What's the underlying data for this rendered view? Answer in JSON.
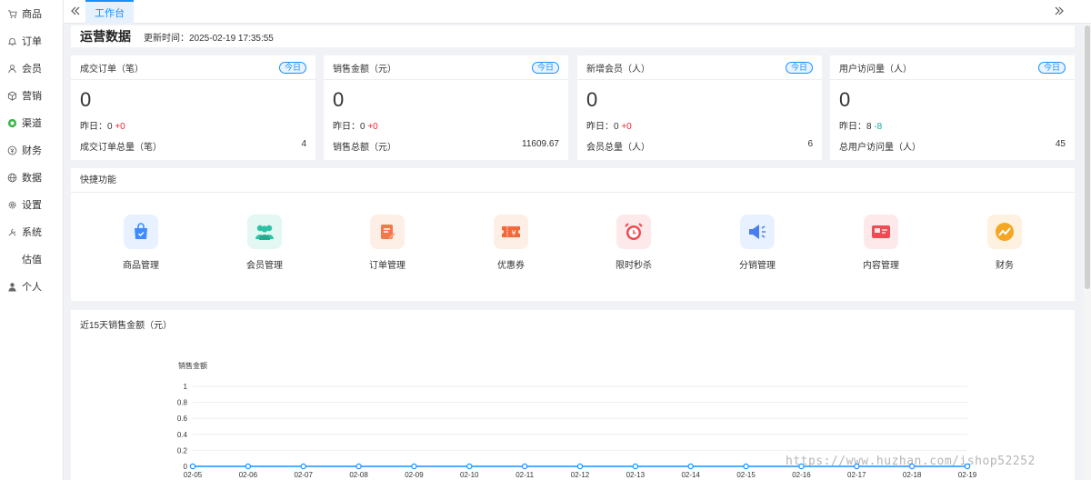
{
  "sidebar": {
    "items": [
      {
        "label": "商品",
        "icon": "cart-icon"
      },
      {
        "label": "订单",
        "icon": "bell-icon"
      },
      {
        "label": "会员",
        "icon": "user-icon"
      },
      {
        "label": "营销",
        "icon": "box-icon"
      },
      {
        "label": "渠道",
        "icon": "channel-icon"
      },
      {
        "label": "财务",
        "icon": "finance-icon"
      },
      {
        "label": "数据",
        "icon": "globe-icon"
      },
      {
        "label": "设置",
        "icon": "gear-icon"
      },
      {
        "label": "系统",
        "icon": "tools-icon"
      },
      {
        "label": "估值",
        "icon": ""
      },
      {
        "label": "个人",
        "icon": "person-icon"
      }
    ]
  },
  "topbar": {
    "tab_label": "工作台"
  },
  "header": {
    "title": "运营数据",
    "update_label": "更新时间：2025-02-19 17:35:55"
  },
  "stats": [
    {
      "title": "成交订单（笔）",
      "badge": "今日",
      "value": "0",
      "yesterday_label": "昨日：",
      "yesterday_value": "0",
      "change": "+0",
      "total_label": "成交订单总量（笔）",
      "total_value": "4"
    },
    {
      "title": "销售金额（元）",
      "badge": "今日",
      "value": "0",
      "yesterday_label": "昨日：",
      "yesterday_value": "0",
      "change": "+0",
      "total_label": "销售总额（元）",
      "total_value": "11609.67"
    },
    {
      "title": "新增会员（人）",
      "badge": "今日",
      "value": "0",
      "yesterday_label": "昨日：",
      "yesterday_value": "0",
      "change": "+0",
      "total_label": "会员总量（人）",
      "total_value": "6"
    },
    {
      "title": "用户访问量（人）",
      "badge": "今日",
      "value": "0",
      "yesterday_label": "昨日：",
      "yesterday_value": "8",
      "change": "-8",
      "total_label": "总用户访问量（人）",
      "total_value": "45"
    }
  ],
  "quick": {
    "title": "快捷功能",
    "items": [
      {
        "label": "商品管理",
        "icon": "shopping-bag-icon",
        "bg": "#e8f1ff",
        "color": "#3d8bfd"
      },
      {
        "label": "会员管理",
        "icon": "members-icon",
        "bg": "#e3f7f3",
        "color": "#2cc2a4"
      },
      {
        "label": "订单管理",
        "icon": "order-icon",
        "bg": "#fdeee6",
        "color": "#f27a4a"
      },
      {
        "label": "优惠券",
        "icon": "coupon-icon",
        "bg": "#fdeee6",
        "color": "#f26a3a"
      },
      {
        "label": "限时秒杀",
        "icon": "alarm-clock-icon",
        "bg": "#fde9ea",
        "color": "#f0484f"
      },
      {
        "label": "分销管理",
        "icon": "megaphone-icon",
        "bg": "#e8f1ff",
        "color": "#4a7df0"
      },
      {
        "label": "内容管理",
        "icon": "content-icon",
        "bg": "#fde9ea",
        "color": "#ef4b55"
      },
      {
        "label": "财务",
        "icon": "trend-icon",
        "bg": "#fff1e0",
        "color": "#f5a623"
      }
    ]
  },
  "chart_data": {
    "type": "line",
    "title": "近15天销售金额（元）",
    "ylabel": "销售金额",
    "xlabel": "",
    "categories": [
      "02-05",
      "02-06",
      "02-07",
      "02-08",
      "02-09",
      "02-10",
      "02-11",
      "02-12",
      "02-13",
      "02-14",
      "02-15",
      "02-16",
      "02-17",
      "02-18",
      "02-19"
    ],
    "series": [
      {
        "values": [
          0,
          0,
          0,
          0,
          0,
          0,
          0,
          0,
          0,
          0,
          0,
          0,
          0,
          0,
          0
        ]
      }
    ],
    "yticks": [
      "0",
      "0.2",
      "0.4",
      "0.6",
      "0.8",
      "1"
    ],
    "ylim": [
      0,
      1
    ],
    "line_color": "#1890ff",
    "grid": true,
    "legend": "none"
  },
  "watermark": "https://www.huzhan.com/ishop52252"
}
